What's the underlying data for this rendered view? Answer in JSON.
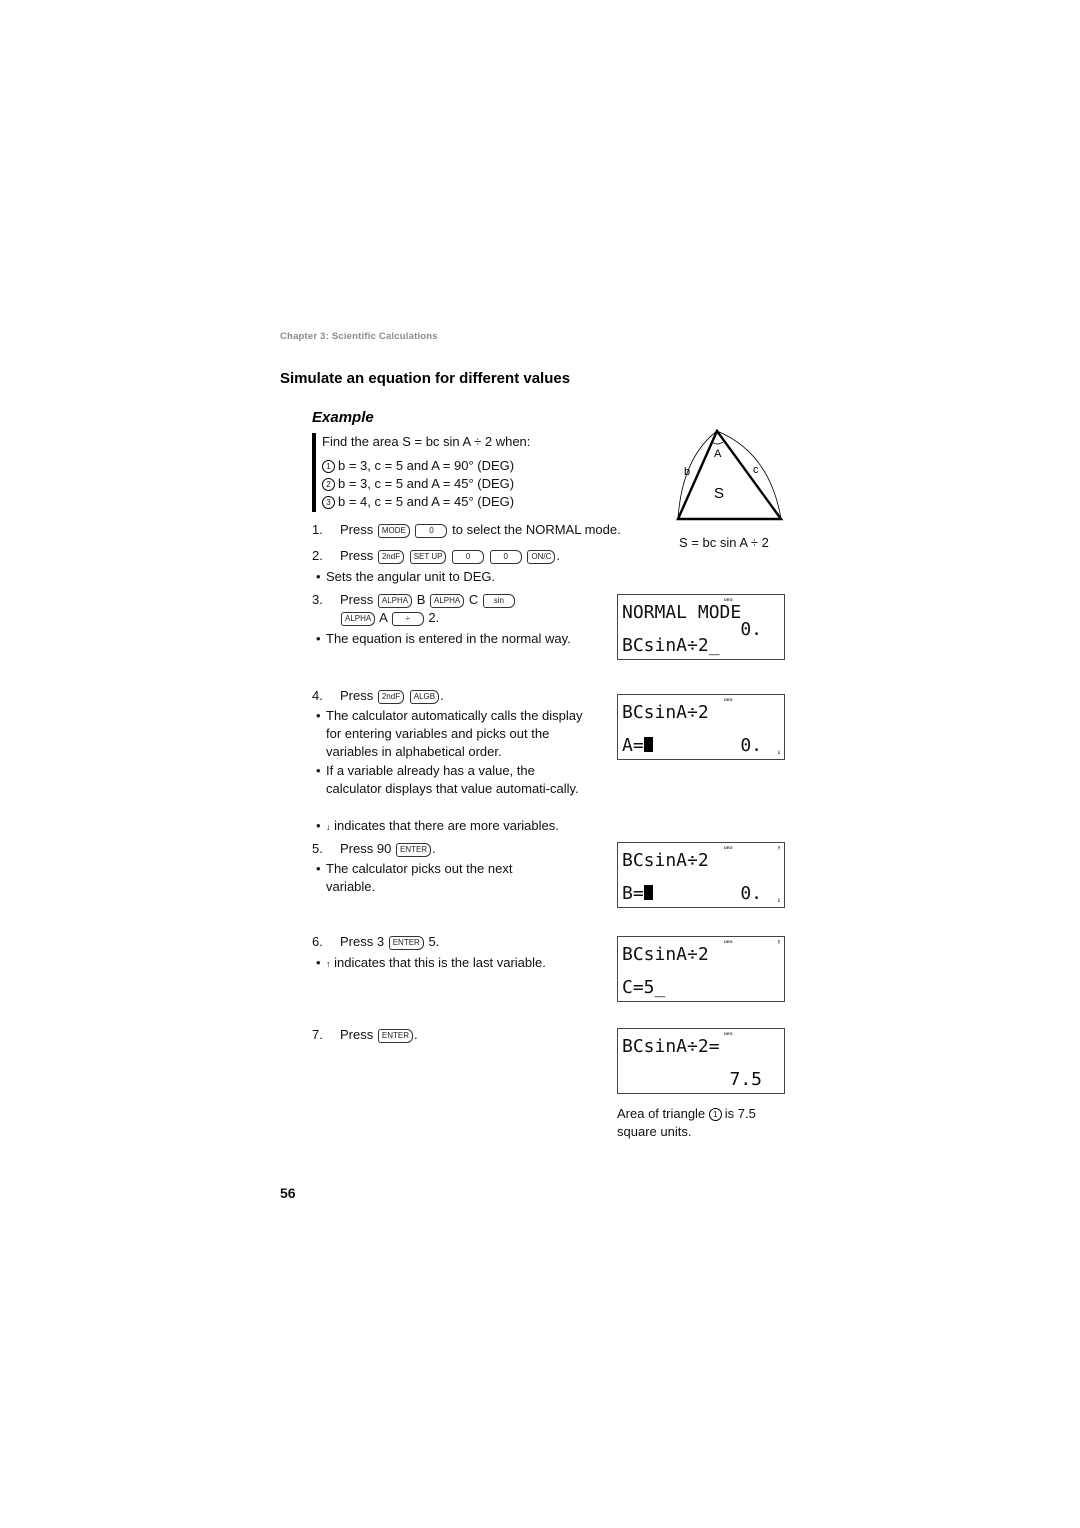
{
  "header": {
    "chapter": "Chapter 3: Scientific Calculations"
  },
  "section": {
    "title": "Simulate an equation for different values"
  },
  "example": {
    "label": "Example",
    "lead": "Find the area S = bc sin A ÷ 2 when:",
    "cases": [
      {
        "marker": "1",
        "text": "b = 3, c = 5 and A = 90° (DEG)"
      },
      {
        "marker": "2",
        "text": "b = 3, c = 5 and A = 45° (DEG)"
      },
      {
        "marker": "3",
        "text": "b = 4, c = 5 and A = 45° (DEG)"
      }
    ]
  },
  "diagram": {
    "labels": {
      "angle": "A",
      "side_b": "b",
      "side_c": "c",
      "area": "S"
    },
    "formula": "S = bc sin A ÷ 2"
  },
  "steps": [
    {
      "num": "1.",
      "press": "Press",
      "keys": [
        "MODE",
        "0"
      ],
      "after": "to select the NORMAL mode."
    },
    {
      "num": "2.",
      "press": "Press",
      "keys": [
        "2ndF",
        "SET UP",
        "0",
        "0",
        "ON/C"
      ],
      "after": "."
    },
    {
      "num": "3.",
      "press": "Press",
      "seq": [
        "ALPHA",
        "B",
        "ALPHA",
        "C",
        "sin",
        "ALPHA",
        "A",
        "÷",
        "2."
      ]
    },
    {
      "num": "4.",
      "press": "Press",
      "keys": [
        "2ndF",
        "ALGB"
      ],
      "after": "."
    },
    {
      "num": "5.",
      "press": "Press 90",
      "keys": [
        "ENTER"
      ],
      "after": "."
    },
    {
      "num": "6.",
      "press": "Press 3",
      "keys": [
        "ENTER"
      ],
      "after": "5."
    },
    {
      "num": "7.",
      "press": "Press",
      "keys": [
        "ENTER"
      ],
      "after": "."
    }
  ],
  "bullets": {
    "deg": "Sets the angular unit to DEG.",
    "normal_way": "The equation is entered in the normal way.",
    "auto_calls": "The calculator automatically calls the display for entering variables and picks out the variables in alphabetical order.",
    "has_value": "If a variable already has a value, the calculator displays that value automati-cally.",
    "more_vars": "indicates that there are more variables.",
    "next_var": "The calculator picks out the next variable.",
    "last_var": "indicates that this is the last variable."
  },
  "displays": [
    {
      "indicator": "DEG",
      "line1": "NORMAL MODE",
      "mid": "0.",
      "line2": "BCsinA÷2_"
    },
    {
      "indicator": "DEG",
      "line1": "BCsinA÷2",
      "line2_label": "A=",
      "line2_value": "0.",
      "down_arrow": "↓"
    },
    {
      "indicator": "DEG",
      "line1": "BCsinA÷2",
      "line2_label": "B=",
      "line2_value": "0.",
      "up_arrow": "↑",
      "down_arrow": "↓"
    },
    {
      "indicator": "DEG",
      "line1": "BCsinA÷2",
      "line2": "C=5_",
      "up_arrow": "↑"
    },
    {
      "indicator": "DEG",
      "line1": "BCsinA÷2=",
      "result": "7.5"
    }
  ],
  "caption": {
    "text_before": "Area of triangle",
    "marker": "1",
    "text_after": "is 7.5 square units."
  },
  "footer": {
    "page_number": "56"
  }
}
